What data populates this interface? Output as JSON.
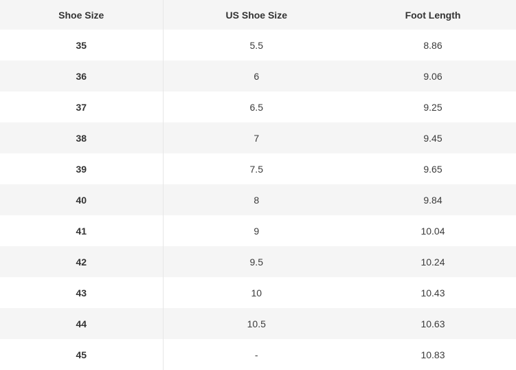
{
  "table": {
    "headers": [
      "Shoe Size",
      "US Shoe Size",
      "Foot Length"
    ],
    "rows": [
      [
        "35",
        "5.5",
        "8.86"
      ],
      [
        "36",
        "6",
        "9.06"
      ],
      [
        "37",
        "6.5",
        "9.25"
      ],
      [
        "38",
        "7",
        "9.45"
      ],
      [
        "39",
        "7.5",
        "9.65"
      ],
      [
        "40",
        "8",
        "9.84"
      ],
      [
        "41",
        "9",
        "10.04"
      ],
      [
        "42",
        "9.5",
        "10.24"
      ],
      [
        "43",
        "10",
        "10.43"
      ],
      [
        "44",
        "10.5",
        "10.63"
      ],
      [
        "45",
        "-",
        "10.83"
      ]
    ]
  },
  "colors": {
    "header_bg": "#f5f5f5",
    "stripe_bg": "#f5f5f5",
    "divider": "#e6e6e6",
    "text": "#3a3a3a"
  }
}
